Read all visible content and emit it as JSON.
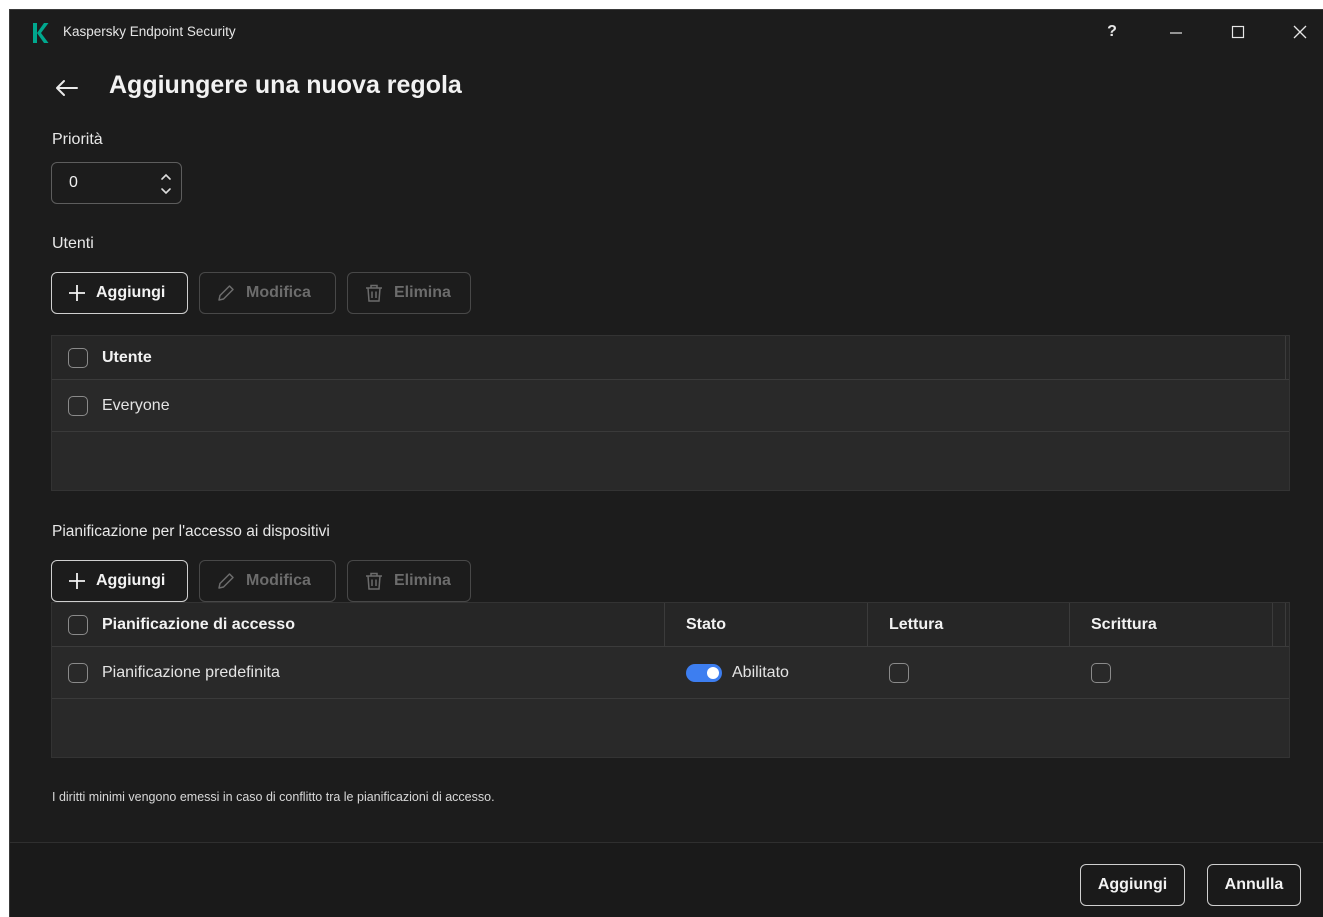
{
  "window": {
    "title": "Kaspersky Endpoint Security",
    "help_label": "?"
  },
  "header": {
    "title": "Aggiungere una nuova regola"
  },
  "priority": {
    "label": "Priorità",
    "value": "0"
  },
  "users": {
    "label": "Utenti",
    "toolbar": {
      "add": "Aggiungi",
      "edit": "Modifica",
      "delete": "Elimina"
    },
    "columns": [
      "Utente"
    ],
    "rows": [
      {
        "name": "Everyone"
      }
    ]
  },
  "schedule": {
    "label": "Pianificazione per l'accesso ai dispositivi",
    "toolbar": {
      "add": "Aggiungi",
      "edit": "Modifica",
      "delete": "Elimina"
    },
    "columns": [
      "Pianificazione di accesso",
      "Stato",
      "Lettura",
      "Scrittura"
    ],
    "rows": [
      {
        "name": "Pianificazione predefinita",
        "status": "Abilitato",
        "status_enabled": true,
        "read": false,
        "write": false
      }
    ]
  },
  "footnote": "I diritti minimi vengono emessi in caso di conflitto tra le pianificazioni di accesso.",
  "footer": {
    "add": "Aggiungi",
    "cancel": "Annulla"
  },
  "colors": {
    "background": "#1c1c1c",
    "accent": "#3d7ef0",
    "logo": "#00a88e"
  }
}
